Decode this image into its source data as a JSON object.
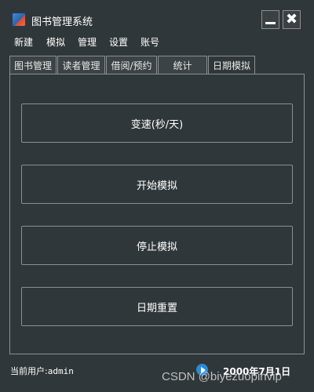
{
  "window": {
    "title": "图书管理系统",
    "minimize_icon": "minimize-icon",
    "close_label": "✖"
  },
  "menu": [
    {
      "label": "新建"
    },
    {
      "label": "模拟"
    },
    {
      "label": "管理"
    },
    {
      "label": "设置"
    },
    {
      "label": "账号"
    }
  ],
  "tabs": [
    {
      "label": "图书管理",
      "active": false
    },
    {
      "label": "读者管理",
      "active": false
    },
    {
      "label": "借阅/预约",
      "active": false
    },
    {
      "label": "统计",
      "active": false
    },
    {
      "label": "日期模拟",
      "active": true
    }
  ],
  "actions": {
    "speed_label": "变速(秒/天)",
    "start_label": "开始模拟",
    "stop_label": "停止模拟",
    "reset_label": "日期重置"
  },
  "status": {
    "user_prefix": "当前用户:",
    "user_name": "admin",
    "date": "2000年7月1日",
    "date_icon": "play-icon"
  },
  "watermark": "CSDN @biyezuopinvip",
  "colors": {
    "background": "#30373a",
    "border": "#8a8f92",
    "accent": "#2a8bd8"
  }
}
